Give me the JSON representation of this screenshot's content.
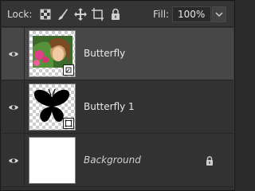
{
  "toolbar": {
    "lock_label": "Lock:",
    "fill_label": "Fill:",
    "fill_value": "100%"
  },
  "layers": [
    {
      "name": "Butterfly",
      "selected": true,
      "visible": true,
      "thumbnail": "photo-smart-object"
    },
    {
      "name": "Butterfly 1",
      "selected": false,
      "visible": true,
      "thumbnail": "butterfly-shape"
    },
    {
      "name": "Background",
      "selected": false,
      "visible": true,
      "locked": true,
      "thumbnail": "white-fill"
    }
  ],
  "colors": {
    "panel_bg": "#323232",
    "selected_row": "#474747",
    "text": "#e8e8e8"
  }
}
